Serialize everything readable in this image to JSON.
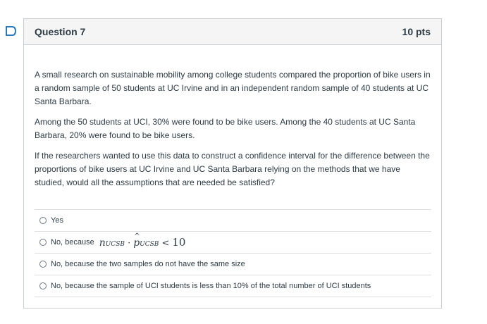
{
  "question": {
    "title": "Question 7",
    "points": "10 pts",
    "paragraphs": [
      "A small research on sustainable mobility among college students compared the proportion of bike users in a random sample of 50 students at UC Irvine and in an independent random sample of 40 students at UC Santa Barbara.",
      "Among the 50 students at UCI, 30% were found to be bike users. Among the 40 students at UC Santa Barbara, 20% were found to be bike users.",
      "If the researchers wanted to use this data to construct a confidence interval for the difference between the proportions of bike users at UC Irvine and UC Santa Barbara relying on the methods that we have studied, would all the assumptions that are needed be satisfied?"
    ],
    "answers": [
      {
        "label": "Yes"
      },
      {
        "label": "No, because",
        "math": {
          "n": "n",
          "n_sub": "UCSB",
          "dot": "·",
          "p": "p",
          "p_sub": "UCSB",
          "cmp": "<",
          "value": "10"
        }
      },
      {
        "label": "No, because the two samples do not have the same size"
      },
      {
        "label": "No, because the sample of UCI students is less than 10% of the total number of UCI students"
      }
    ]
  },
  "colors": {
    "flag_border": "#2b7abc",
    "header_bg": "#f5f5f5",
    "border": "#c7cdd1",
    "text": "#2d3b45"
  },
  "icons": {
    "flag": "bookmark-flag-icon"
  }
}
